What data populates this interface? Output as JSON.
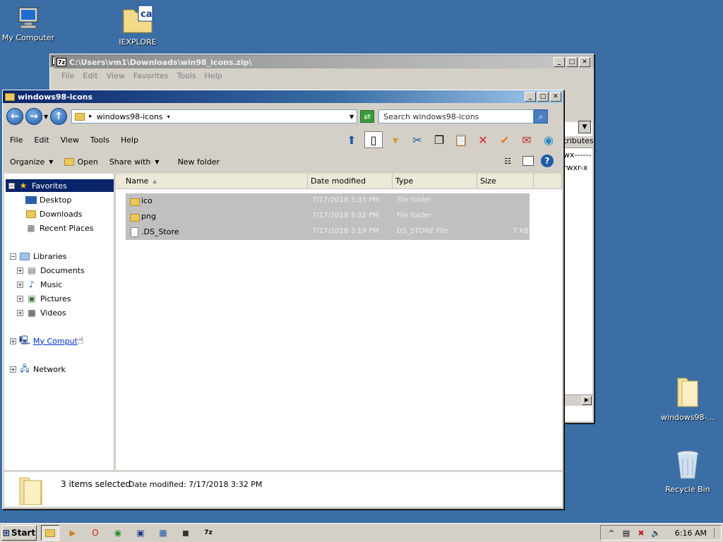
{
  "desktop": {
    "icons": [
      {
        "label": "My Computer",
        "icon": "computer-icon"
      },
      {
        "label": "IEXPLORE",
        "icon": "ca-folder-icon"
      },
      {
        "label": "windows98-...",
        "icon": "folder-icon"
      },
      {
        "label": "Recycle Bin",
        "icon": "recycle-bin-icon"
      }
    ]
  },
  "sevenzip": {
    "title": "C:\\Users\\vm1\\Downloads\\win98_icons.zip\\",
    "menu": [
      "File",
      "Edit",
      "View",
      "Favorites",
      "Tools",
      "Help"
    ],
    "column_attributes": "tributes",
    "attr_values": [
      "wx------",
      "rwxr-x"
    ]
  },
  "explorer": {
    "title": "windows98-icons",
    "address": "windows98-icons",
    "search_placeholder": "Search windows98-icons",
    "menu": [
      "File",
      "Edit",
      "View",
      "Tools",
      "Help"
    ],
    "commands": {
      "organize": "Organize",
      "open": "Open",
      "share_with": "Share with",
      "new_folder": "New folder"
    },
    "nav": {
      "favorites": "Favorites",
      "desktop": "Desktop",
      "downloads": "Downloads",
      "recent_places": "Recent Places",
      "libraries": "Libraries",
      "documents": "Documents",
      "music": "Music",
      "pictures": "Pictures",
      "videos": "Videos",
      "my_computer": "My Comput",
      "network": "Network"
    },
    "columns": {
      "name": "Name",
      "date_modified": "Date modified",
      "type": "Type",
      "size": "Size"
    },
    "files": [
      {
        "name": "ico",
        "date": "7/17/2018 3:33 PM",
        "type": "File folder",
        "size": ""
      },
      {
        "name": "png",
        "date": "7/17/2018 3:32 PM",
        "type": "File folder",
        "size": ""
      },
      {
        "name": ".DS_Store",
        "date": "7/17/2018 3:19 PM",
        "type": "DS_STORE File",
        "size": "7 KB"
      }
    ],
    "details": {
      "selection": "3 items selected",
      "date_modified": "Date modified: 7/17/2018 3:32 PM"
    }
  },
  "taskbar": {
    "start_label": "Start",
    "clock": "6:16 AM"
  }
}
